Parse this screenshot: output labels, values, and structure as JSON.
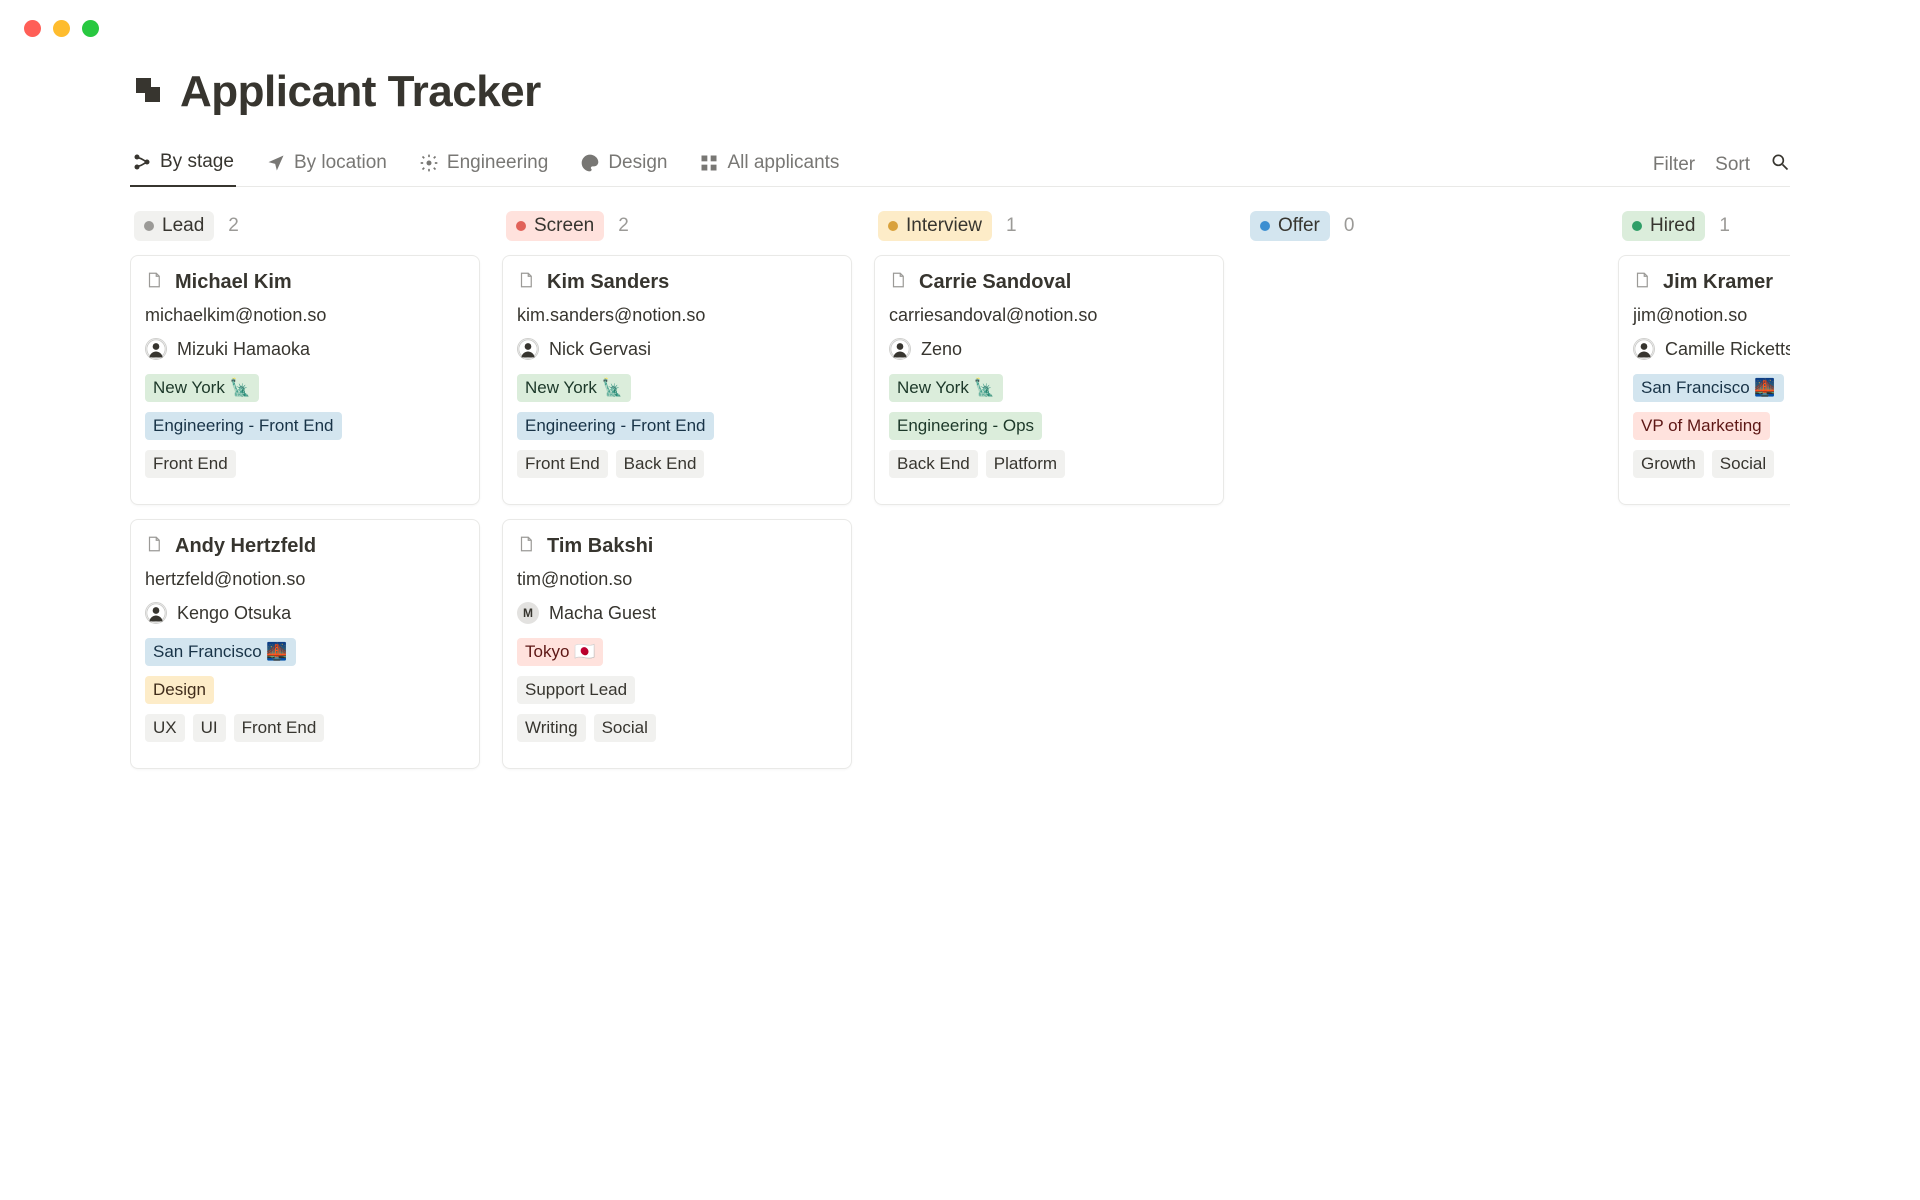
{
  "window": {
    "title": "Applicant Tracker"
  },
  "tabs": [
    {
      "label": "By stage",
      "icon": "branch",
      "active": true
    },
    {
      "label": "By location",
      "icon": "nav-arrow",
      "active": false
    },
    {
      "label": "Engineering",
      "icon": "gear",
      "active": false
    },
    {
      "label": "Design",
      "icon": "palette",
      "active": false
    },
    {
      "label": "All applicants",
      "icon": "grid",
      "active": false
    }
  ],
  "toolbar": {
    "filter": "Filter",
    "sort": "Sort"
  },
  "stages": [
    {
      "id": "lead",
      "label": "Lead",
      "count": "2",
      "pill_class": "pill-lead",
      "dot_class": "dot-lead"
    },
    {
      "id": "screen",
      "label": "Screen",
      "count": "2",
      "pill_class": "pill-screen",
      "dot_class": "dot-screen"
    },
    {
      "id": "interview",
      "label": "Interview",
      "count": "1",
      "pill_class": "pill-interview",
      "dot_class": "dot-interview"
    },
    {
      "id": "offer",
      "label": "Offer",
      "count": "0",
      "pill_class": "pill-offer",
      "dot_class": "dot-offer"
    },
    {
      "id": "hired",
      "label": "Hired",
      "count": "1",
      "pill_class": "pill-hired",
      "dot_class": "dot-hired"
    }
  ],
  "cards": {
    "lead": [
      {
        "name": "Michael Kim",
        "email": "michaelkim@notion.so",
        "person": {
          "name": "Mizuki Hamaoka",
          "avatar_type": "img"
        },
        "location": {
          "label": "New York 🗽",
          "class": "loc-ny"
        },
        "role": {
          "label": "Engineering - Front End",
          "class": "role-blue"
        },
        "skills": [
          "Front End"
        ]
      },
      {
        "name": "Andy Hertzfeld",
        "email": "hertzfeld@notion.so",
        "person": {
          "name": "Kengo Otsuka",
          "avatar_type": "img"
        },
        "location": {
          "label": "San Francisco 🌉",
          "class": "loc-sf"
        },
        "role": {
          "label": "Design",
          "class": "role-yellow"
        },
        "skills": [
          "UX",
          "UI",
          "Front End"
        ]
      }
    ],
    "screen": [
      {
        "name": "Kim Sanders",
        "email": "kim.sanders@notion.so",
        "person": {
          "name": "Nick Gervasi",
          "avatar_type": "img"
        },
        "location": {
          "label": "New York 🗽",
          "class": "loc-ny"
        },
        "role": {
          "label": "Engineering - Front End",
          "class": "role-blue"
        },
        "skills": [
          "Front End",
          "Back End"
        ]
      },
      {
        "name": "Tim Bakshi",
        "email": "tim@notion.so",
        "person": {
          "name": "Macha Guest",
          "avatar_type": "letter",
          "initial": "M"
        },
        "location": {
          "label": "Tokyo 🇯🇵",
          "class": "loc-tokyo"
        },
        "role": {
          "label": "Support Lead",
          "class": "role-grey"
        },
        "skills": [
          "Writing",
          "Social"
        ]
      }
    ],
    "interview": [
      {
        "name": "Carrie Sandoval",
        "email": "carriesandoval@notion.so",
        "person": {
          "name": "Zeno",
          "avatar_type": "img"
        },
        "location": {
          "label": "New York 🗽",
          "class": "loc-ny"
        },
        "role": {
          "label": "Engineering - Ops",
          "class": "role-green"
        },
        "skills": [
          "Back End",
          "Platform"
        ]
      }
    ],
    "offer": [],
    "hired": [
      {
        "name": "Jim Kramer",
        "email": "jim@notion.so",
        "person": {
          "name": "Camille Ricketts",
          "avatar_type": "img"
        },
        "location": {
          "label": "San Francisco 🌉",
          "class": "loc-sf"
        },
        "role": {
          "label": "VP of Marketing",
          "class": "role-red"
        },
        "skills": [
          "Growth",
          "Social"
        ]
      }
    ]
  }
}
